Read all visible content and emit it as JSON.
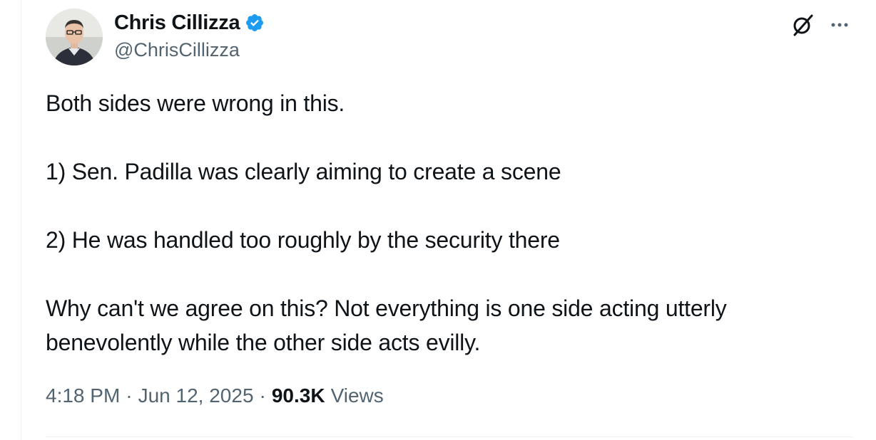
{
  "author": {
    "display_name": "Chris Cillizza",
    "handle": "@ChrisCillizza",
    "verified": true,
    "verified_color": "#1d9bf0",
    "avatar_icon": "profile-photo"
  },
  "header_icons": {
    "grok": "grok-icon",
    "more": "more-options-icon"
  },
  "tweet": {
    "paragraphs": [
      "Both sides were wrong in this.",
      "1) Sen. Padilla was clearly aiming to create a scene",
      "2) He was handled too roughly by the security there",
      "Why can't we agree on this? Not everything is one side acting utterly benevolently while the other side acts evilly."
    ]
  },
  "meta": {
    "time": "4:18 PM",
    "separator": "·",
    "date": "Jun 12, 2025",
    "views_count": "90.3K",
    "views_label": "Views"
  },
  "colors": {
    "text_primary": "#0f1419",
    "text_secondary": "#536471",
    "divider": "#eff3f4"
  }
}
